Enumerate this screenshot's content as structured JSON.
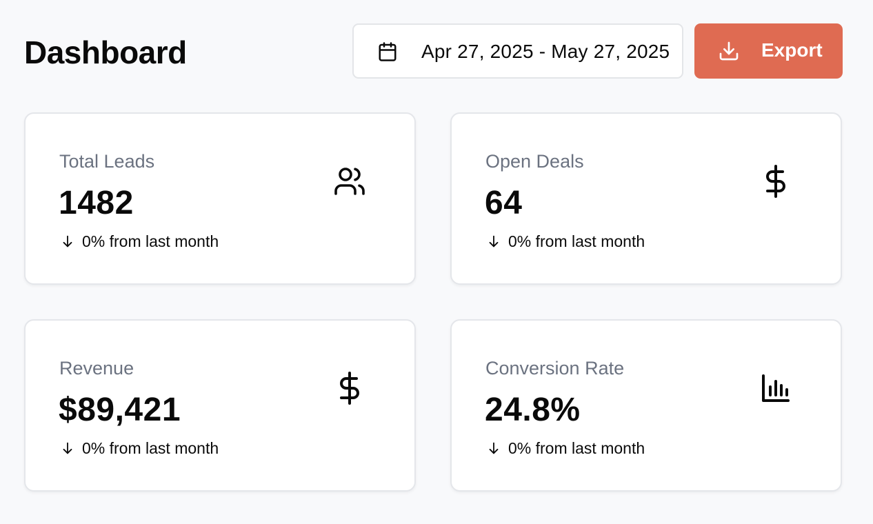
{
  "header": {
    "title": "Dashboard",
    "date_range": {
      "icon": "calendar-icon",
      "value": "Apr 27, 2025 - May 27, 2025"
    },
    "export": {
      "icon": "download-icon",
      "label": "Export",
      "color": "#df6b52"
    }
  },
  "cards": [
    {
      "label": "Total Leads",
      "value": "1482",
      "change": "0% from last month",
      "icon": "users-icon"
    },
    {
      "label": "Open Deals",
      "value": "64",
      "change": "0% from last month",
      "icon": "dollar-icon"
    },
    {
      "label": "Revenue",
      "value": "$89,421",
      "change": "0% from last month",
      "icon": "dollar-icon"
    },
    {
      "label": "Conversion Rate",
      "value": "24.8%",
      "change": "0% from last month",
      "icon": "bar-chart-icon"
    }
  ],
  "colors": {
    "background": "#f8f9fb",
    "muted_text": "#6b7280",
    "accent": "#df6b52"
  }
}
